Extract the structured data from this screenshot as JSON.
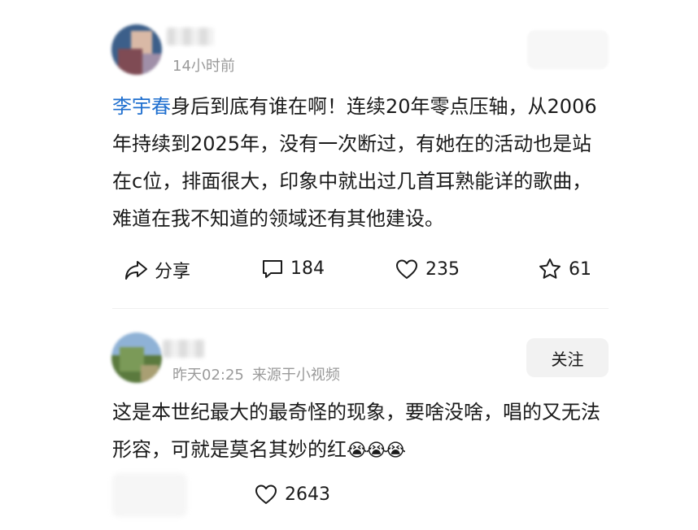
{
  "post1": {
    "time": "14小时前",
    "mention": "李宇春",
    "body": "身后到底有谁在啊！连续20年零点压轴，从2006年持续到2025年，没有一次断过，有她在的活动也是站在c位，排面很大，印象中就出过几首耳熟能详的歌曲，难道在我不知道的领域还有其他建设。",
    "share_label": "分享",
    "comments": "184",
    "likes": "235",
    "favorites": "61"
  },
  "post2": {
    "time": "昨天02:25",
    "source": "来源于小视频",
    "follow_label": "关注",
    "body": "这是本世纪最大的最奇怪的现象，要啥没啥，唱的又无法形容，可就是莫名其妙的红",
    "emoji": "😭😭😭",
    "likes": "2643"
  },
  "colors": {
    "mention": "#1f6fcf",
    "meta": "#9a9a9a",
    "follow_bg": "#f2f2f2"
  },
  "icons": [
    "share-icon",
    "comment-icon",
    "heart-icon",
    "star-icon"
  ]
}
